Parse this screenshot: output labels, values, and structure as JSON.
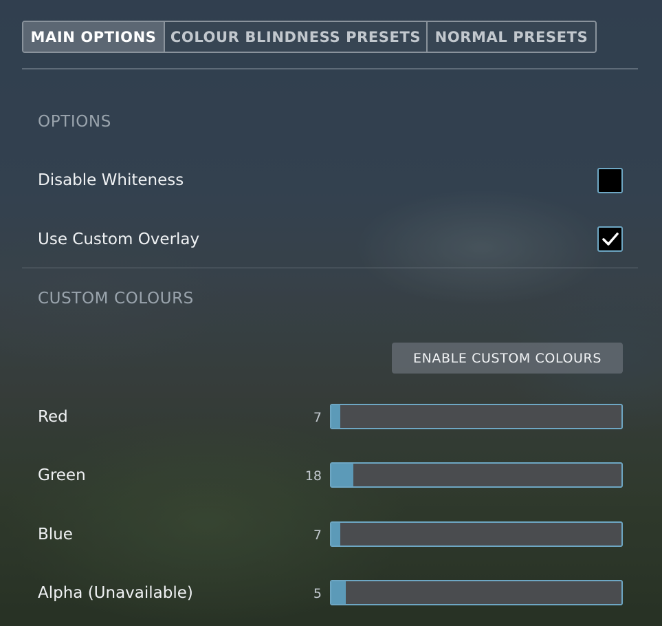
{
  "tabs": [
    {
      "label": "MAIN OPTIONS",
      "active": true
    },
    {
      "label": "COLOUR BLINDNESS PRESETS",
      "active": false
    },
    {
      "label": "NORMAL PRESETS",
      "active": false
    }
  ],
  "options": {
    "title": "OPTIONS",
    "items": [
      {
        "label": "Disable Whiteness",
        "checked": false
      },
      {
        "label": "Use Custom Overlay",
        "checked": true
      }
    ]
  },
  "custom_colours": {
    "title": "CUSTOM COLOURS",
    "button_label": "ENABLE CUSTOM COLOURS",
    "sliders": [
      {
        "label": "Red",
        "value": "7",
        "fill_percent": 3
      },
      {
        "label": "Green",
        "value": "18",
        "fill_percent": 7.5
      },
      {
        "label": "Blue",
        "value": "7",
        "fill_percent": 3
      },
      {
        "label": "Alpha (Unavailable)",
        "value": "5",
        "fill_percent": 5
      }
    ]
  },
  "colors": {
    "accent": "#6ea7c4",
    "slider_fill": "#5c9ab8",
    "active_tab": "#5c6773"
  }
}
